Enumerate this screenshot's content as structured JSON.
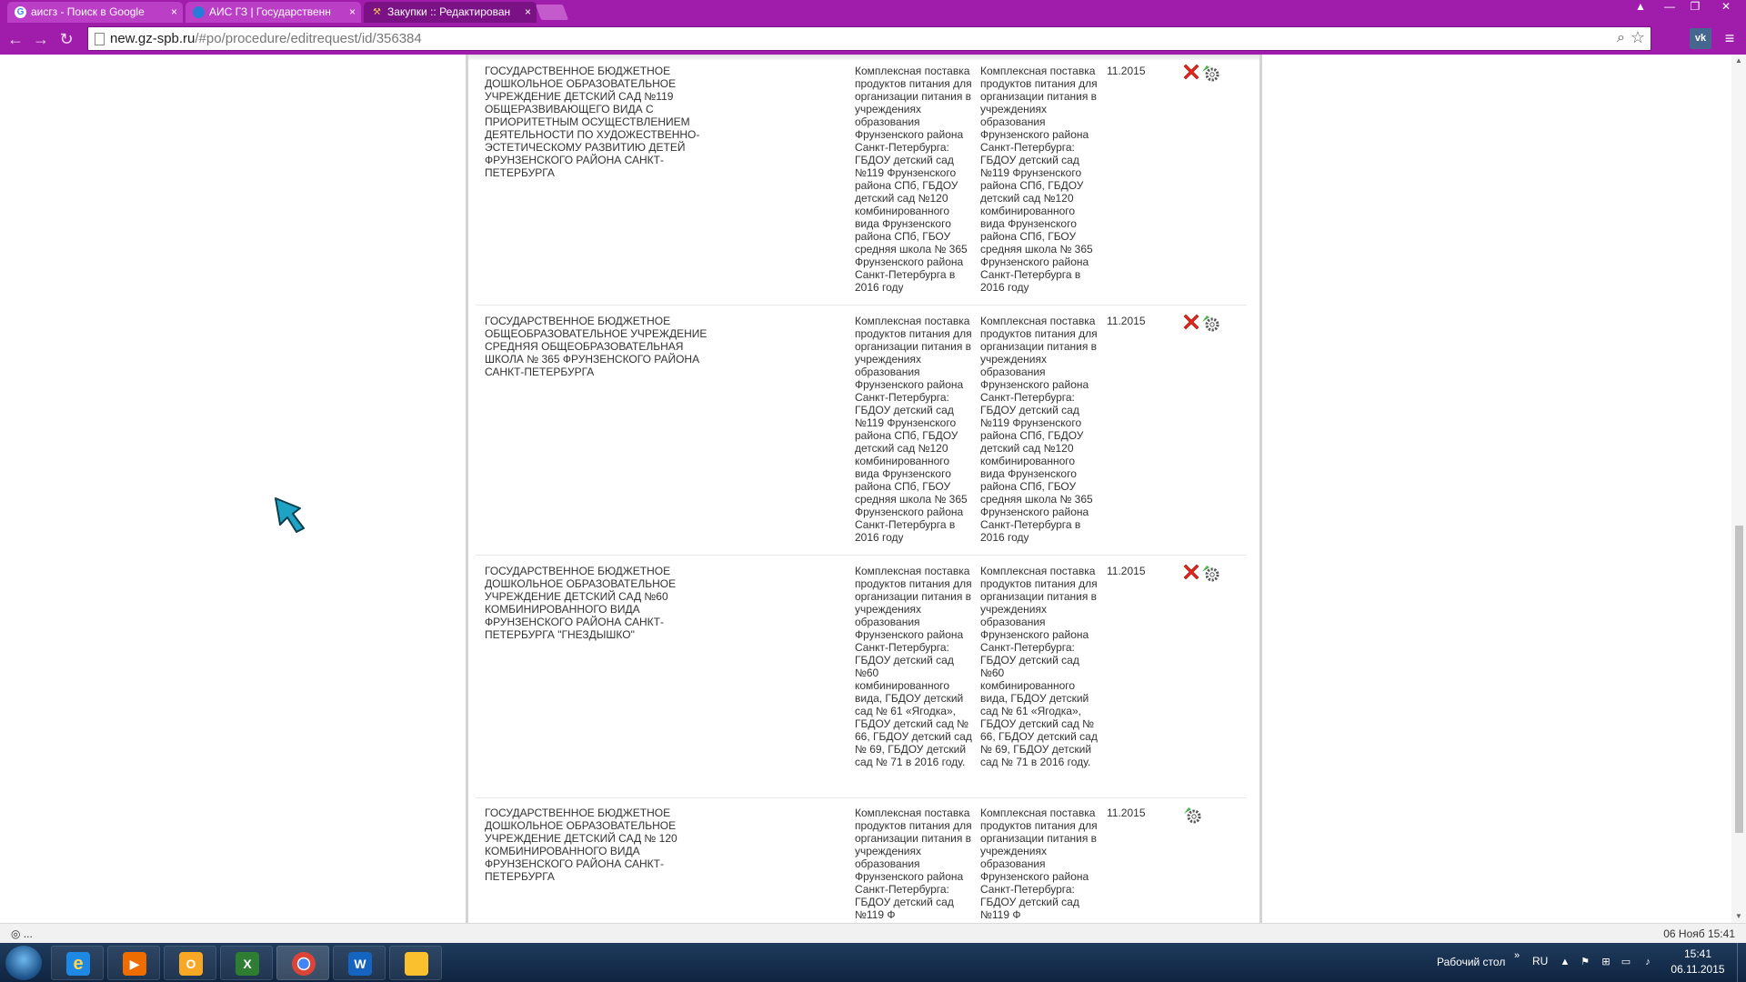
{
  "browser": {
    "tabs": [
      {
        "label": "аисгз - Поиск в Google",
        "active": false
      },
      {
        "label": "АИС ГЗ | Государственн",
        "active": false
      },
      {
        "label": "Закупки :: Редактирован",
        "active": true
      }
    ],
    "url_host": "new.gz-spb.ru",
    "url_path": "/#po/procedure/editrequest/id/356384",
    "extension_label": "vk"
  },
  "rows": [
    {
      "organization": "ГОСУДАРСТВЕННОЕ БЮДЖЕТНОЕ ДОШКОЛЬНОЕ ОБРАЗОВАТЕЛЬНОЕ УЧРЕЖДЕНИЕ ДЕТСКИЙ САД №119 ОБЩЕРАЗВИВАЮЩЕГО ВИДА С ПРИОРИТЕТНЫМ ОСУЩЕСТВЛЕНИЕМ ДЕЯТЕЛЬНОСТИ ПО ХУДОЖЕСТВЕННО-ЭСТЕТИЧЕСКОМУ РАЗВИТИЮ ДЕТЕЙ ФРУНЗЕНСКОГО РАЙОНА САНКТ-ПЕТЕРБУРГА",
      "subject": "Комплексная поставка продуктов питания для организации питания в учреждениях образования Фрунзенского района Санкт-Петербурга: ГБДОУ детский сад №119 Фрунзенского района СПб, ГБДОУ детский сад №120 комбинированного вида Фрунзенского района СПб, ГБОУ средняя школа № 365 Фрунзенского района Санкт-Петербурга в 2016 году",
      "subject_alt": "Комплексная поставка продуктов питания для организации питания в учреждениях образования Фрунзенского района Санкт-Петербурга: ГБДОУ детский сад №119 Фрунзенского района СПб, ГБДОУ детский сад №120 комбинированного вида Фрунзенского района СПб, ГБОУ средняя школа № 365 Фрунзенского района Санкт-Петербурга в 2016 году",
      "date": "11.2015",
      "deletable": true
    },
    {
      "organization": "ГОСУДАРСТВЕННОЕ БЮДЖЕТНОЕ ОБЩЕОБРАЗОВАТЕЛЬНОЕ УЧРЕЖДЕНИЕ СРЕДНЯЯ ОБЩЕОБРАЗОВАТЕЛЬНАЯ ШКОЛА № 365 ФРУНЗЕНСКОГО РАЙОНА САНКТ-ПЕТЕРБУРГА",
      "subject": "Комплексная поставка продуктов питания для организации питания в учреждениях образования Фрунзенского района Санкт-Петербурга: ГБДОУ детский сад №119 Фрунзенского района СПб, ГБДОУ детский сад №120 комбинированного вида Фрунзенского района СПб, ГБОУ средняя школа № 365 Фрунзенского района Санкт-Петербурга в 2016 году",
      "subject_alt": "Комплексная поставка продуктов питания для организации питания в учреждениях образования Фрунзенского района Санкт-Петербурга: ГБДОУ детский сад №119 Фрунзенского района СПб, ГБДОУ детский сад №120 комбинированного вида Фрунзенского района СПб, ГБОУ средняя школа № 365 Фрунзенского района Санкт-Петербурга в 2016 году",
      "date": "11.2015",
      "deletable": true
    },
    {
      "organization": "ГОСУДАРСТВЕННОЕ БЮДЖЕТНОЕ ДОШКОЛЬНОЕ ОБРАЗОВАТЕЛЬНОЕ УЧРЕЖДЕНИЕ ДЕТСКИЙ САД №60 КОМБИНИРОВАННОГО ВИДА ФРУНЗЕНСКОГО РАЙОНА САНКТ-ПЕТЕРБУРГА \"ГНЕЗДЫШКО\"",
      "subject": "Комплексная поставка продуктов питания для организации питания в учреждениях образования Фрунзенского района Санкт-Петербурга: ГБДОУ детский сад №60 комбинированного вида, ГБДОУ детский сад № 61 «Ягодка», ГБДОУ детский сад № 66, ГБДОУ детский сад № 69, ГБДОУ детский сад № 71 в 2016 году.",
      "subject_alt": "Комплексная поставка продуктов питания для организации питания в учреждениях образования Фрунзенского района Санкт-Петербурга: ГБДОУ детский сад №60 комбинированного вида, ГБДОУ детский сад № 61 «Ягодка», ГБДОУ детский сад № 66, ГБДОУ детский сад № 69, ГБДОУ детский сад № 71 в 2016 году.",
      "date": "11.2015",
      "deletable": true
    },
    {
      "organization": "ГОСУДАРСТВЕННОЕ БЮДЖЕТНОЕ ДОШКОЛЬНОЕ ОБРАЗОВАТЕЛЬНОЕ УЧРЕЖДЕНИЕ ДЕТСКИЙ САД № 120 КОМБИНИРОВАННОГО ВИДА ФРУНЗЕНСКОГО РАЙОНА САНКТ-ПЕТЕРБУРГА",
      "subject": "Комплексная поставка продуктов питания для организации питания в учреждениях образования Фрунзенского района Санкт-Петербурга: ГБДОУ детский сад №119 Ф",
      "subject_alt": "Комплексная поставка продуктов питания для организации питания в учреждениях образования Фрунзенского района Санкт-Петербурга: ГБДОУ детский сад №119 Ф",
      "date": "11.2015",
      "deletable": false
    }
  ],
  "statusbar": {
    "loading_text": "◎ ...",
    "datetime": "06 Нояб 15:41"
  },
  "taskbar": {
    "desktop_label": "Рабочий стол",
    "lang": "RU",
    "clock_time": "15:41",
    "clock_date": "06.11.2015"
  },
  "colors": {
    "chrome_accent": "#a01caa",
    "delete_icon": "#e2261c",
    "gear_icon": "#4caf50"
  }
}
